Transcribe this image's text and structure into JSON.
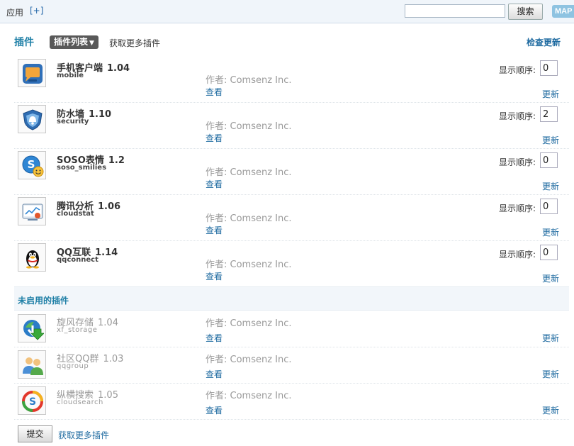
{
  "topbar": {
    "app_label": "应用",
    "app_add": "[+]",
    "search_value": "",
    "search_button": "搜索",
    "map_button": "MAP"
  },
  "header": {
    "title": "插件",
    "tab_list": "插件列表",
    "tab_more": "获取更多插件",
    "check_update": "检查更新"
  },
  "enabled_plugins": [
    {
      "name": "手机客户端",
      "version": "1.04",
      "id": "mobile",
      "author": "作者: Comsenz Inc.",
      "view": "查看",
      "order_label": "显示顺序:",
      "order": "0",
      "update": "更新",
      "icon": "mobile-icon"
    },
    {
      "name": "防水墙",
      "version": "1.10",
      "id": "security",
      "author": "作者: Comsenz Inc.",
      "view": "查看",
      "order_label": "显示顺序:",
      "order": "2",
      "update": "更新",
      "icon": "security-shield-icon"
    },
    {
      "name": "SOSO表情",
      "version": "1.2",
      "id": "soso_smilies",
      "author": "作者: Comsenz Inc.",
      "view": "查看",
      "order_label": "显示顺序:",
      "order": "0",
      "update": "更新",
      "icon": "soso-smilies-icon"
    },
    {
      "name": "腾讯分析",
      "version": "1.06",
      "id": "cloudstat",
      "author": "作者: Comsenz Inc.",
      "view": "查看",
      "order_label": "显示顺序:",
      "order": "0",
      "update": "更新",
      "icon": "cloudstat-icon"
    },
    {
      "name": "QQ互联",
      "version": "1.14",
      "id": "qqconnect",
      "author": "作者: Comsenz Inc.",
      "view": "查看",
      "order_label": "显示顺序:",
      "order": "0",
      "update": "更新",
      "icon": "qq-penguin-icon"
    }
  ],
  "disabled_section": {
    "title": "未启用的插件"
  },
  "disabled_plugins": [
    {
      "name": "旋风存储",
      "version": "1.04",
      "id": "xf_storage",
      "author": "作者: Comsenz Inc.",
      "view": "查看",
      "update": "更新",
      "icon": "storage-download-icon"
    },
    {
      "name": "社区QQ群",
      "version": "1.03",
      "id": "qqgroup",
      "author": "作者: Comsenz Inc.",
      "view": "查看",
      "update": "更新",
      "icon": "qq-group-icon"
    },
    {
      "name": "纵横搜索",
      "version": "1.05",
      "id": "cloudsearch",
      "author": "作者: Comsenz Inc.",
      "view": "查看",
      "update": "更新",
      "icon": "cloudsearch-icon"
    }
  ],
  "footer": {
    "submit": "提交",
    "more": "获取更多插件"
  },
  "colors": {
    "accent": "#1e7fa6",
    "link": "#1e6aa0",
    "topbar_bg": "#f0f5fa",
    "tab_bg": "#595959",
    "map_bg": "#8ec3e1"
  }
}
